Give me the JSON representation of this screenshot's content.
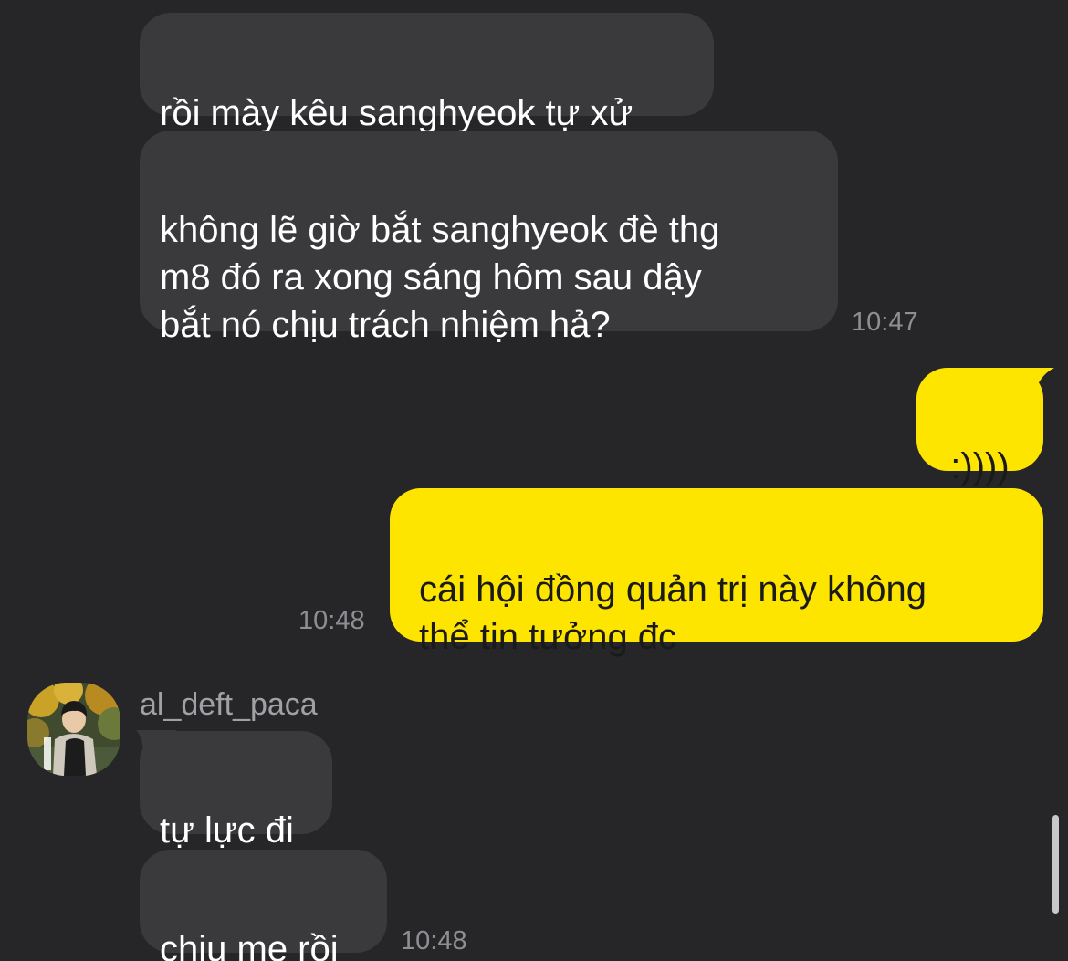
{
  "messages": [
    {
      "text": "rồi mày kêu sanghyeok tự xử"
    },
    {
      "text": "không lẽ giờ bắt sanghyeok đè thg\nm8 đó ra xong sáng hôm sau dậy\nbắt nó chịu trách nhiệm hả?",
      "time": "10:47"
    },
    {
      "text": ":))))"
    },
    {
      "text": "cái hội đồng quản trị này không\nthể tin tưởng đc",
      "time": "10:48"
    },
    {
      "sender": "al_deft_paca",
      "text": "tự lực đi"
    },
    {
      "text": "chịu mẹ rồi",
      "time": "10:48"
    }
  ],
  "colors": {
    "background": "#262628",
    "incoming_bubble": "#3a3a3c",
    "outgoing_bubble": "#fee500",
    "timestamp": "#8e8e93"
  }
}
